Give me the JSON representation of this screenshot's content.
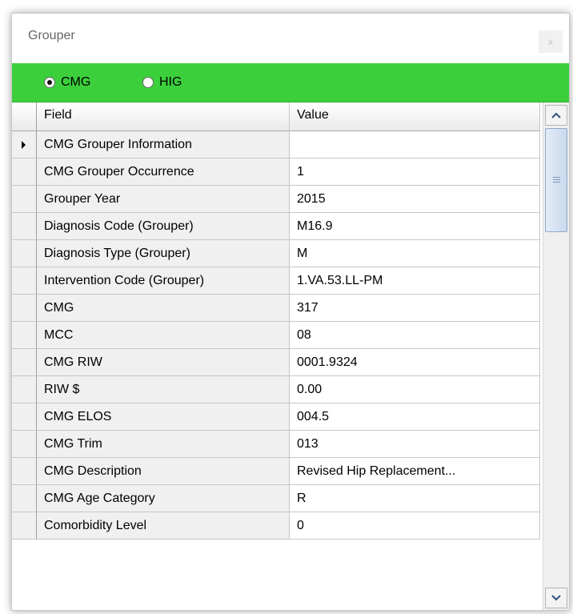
{
  "window": {
    "title": "Grouper",
    "close_glyph": "x"
  },
  "selector": {
    "options": [
      {
        "label": "CMG",
        "checked": true
      },
      {
        "label": "HIG",
        "checked": false
      }
    ]
  },
  "grid": {
    "columns": [
      "Field",
      "Value"
    ],
    "current_row_index": 0,
    "rows": [
      {
        "field": "CMG Grouper Information",
        "value": ""
      },
      {
        "field": "CMG Grouper Occurrence",
        "value": "1"
      },
      {
        "field": "Grouper Year",
        "value": "2015"
      },
      {
        "field": "Diagnosis Code (Grouper)",
        "value": "M16.9"
      },
      {
        "field": "Diagnosis Type (Grouper)",
        "value": "M"
      },
      {
        "field": "Intervention Code (Grouper)",
        "value": "1.VA.53.LL-PM"
      },
      {
        "field": "CMG",
        "value": "317"
      },
      {
        "field": "MCC",
        "value": "08"
      },
      {
        "field": "CMG RIW",
        "value": "0001.9324"
      },
      {
        "field": "RIW $",
        "value": "0.00"
      },
      {
        "field": "CMG ELOS",
        "value": "004.5"
      },
      {
        "field": "CMG Trim",
        "value": "013"
      },
      {
        "field": "CMG Description",
        "value": "Revised Hip Replacement..."
      },
      {
        "field": "CMG Age Category",
        "value": "R"
      },
      {
        "field": "Comorbidity Level",
        "value": "0"
      }
    ]
  },
  "colors": {
    "toolbar_background": "#3ccf3c",
    "header_cell": "#f0f0f0",
    "value_cell": "#ffffff"
  },
  "icons": {
    "close": "close-icon",
    "row_indicator": "current-row-arrow-icon",
    "scroll_up": "chevron-up-icon",
    "scroll_down": "chevron-down-icon"
  }
}
